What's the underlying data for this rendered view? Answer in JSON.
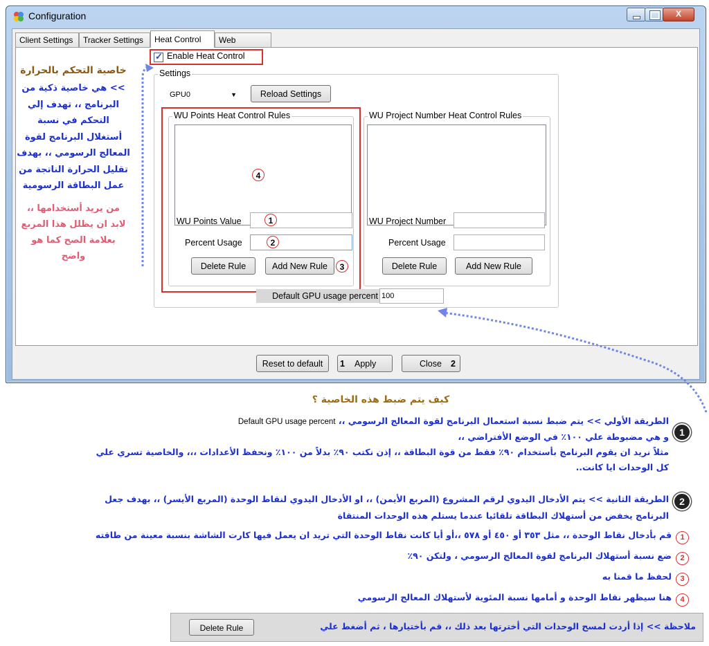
{
  "window": {
    "title": "Configuration",
    "controls": {
      "minimize": "",
      "maximize": "",
      "close": "X"
    }
  },
  "tabs": [
    {
      "label": "Client Settings"
    },
    {
      "label": "Tracker Settings"
    },
    {
      "label": "Heat Control"
    },
    {
      "label": "Web Settings"
    }
  ],
  "heat_control": {
    "enable_label": "Enable Heat Control",
    "enable_checked": true,
    "settings_group_label": "Settings",
    "gpu_select": "GPU0",
    "reload_button": "Reload Settings",
    "wu_points": {
      "group_label": "WU Points Heat Control Rules",
      "value_label": "WU Points Value",
      "value": "",
      "percent_label": "Percent Usage",
      "percent": "",
      "delete_button": "Delete Rule",
      "add_button": "Add New Rule"
    },
    "wu_project": {
      "group_label": "WU Project Number Heat Control Rules",
      "number_label": "WU Project Number",
      "number": "",
      "percent_label": "Percent Usage",
      "percent": "",
      "delete_button": "Delete Rule",
      "add_button": "Add New Rule"
    },
    "default_gpu_label": "Default GPU usage percent",
    "default_gpu_value": "100"
  },
  "footer_buttons": {
    "reset": "Reset to default",
    "apply": "Apply",
    "close": "Close"
  },
  "markers": {
    "m1": "1",
    "m2": "2",
    "m3": "3",
    "m4": "4"
  },
  "annotations": {
    "left_title": "خاصية التحكم بالحرارة",
    "left_blue": [
      ">> هي خاصية ذكية من",
      "البرنامج ،، تهدف إلي",
      "التحكم في نسبة",
      "أستغلال البرنامج لقوة",
      "المعالج الرسومي ،، بهدف",
      "تقليل الحرارة الناتجة من",
      "عمل البطاقة الرسومية"
    ],
    "left_pink": [
      "من يريد أستخدامها ،،",
      "لابد ان يظلل هذا المربع",
      "بعلامة الصح كما هو",
      "واضح"
    ],
    "how_title": "كيف يتم ضبط هذه الخاصية ؟",
    "method1": {
      "number": "1",
      "line1": "الطريقة الأولي >> يتم ضبط نسبة استعمال البرنامج لقوة المعالج الرسومي ،،",
      "line1_en": "Default GPU usage percent",
      "line2": "و هي مضبوطة علي ١٠٠٪ في الوضع الأفتراضي ،،",
      "line3": "مثلاً نريد ان يقوم البرنامج بأستخدام ٩٠٪ فقط من قوة البطاقة ،، إذن نكتب ٩٠٪ بدلاً من ١٠٠٪ ونحفظ الأعدادات ،،، والخاصية تسري علي",
      "line4": "كل الوحدات ايا كانت.."
    },
    "method2": {
      "number": "2",
      "line1": "الطريقة الثانية >> يتم الأدخال اليدوي لرقم المشروع (المربع الأيمن) ،، او الأدخال اليدوي لنقاط الوحدة (المربع الأيسر) ،، بهدف جعل",
      "line2": "البرنامج يخفض من أستهلاك البطاقة تلقائيا عندما يستلم هذه الوحدات المنتقاة"
    },
    "steps": [
      {
        "n": "1",
        "text": "قم بأدخال نقاط الوحدة ،، مثل ٣٥٣ أو ٤٥٠ أو ٥٧٨ ،،أو أيا كانت نقاط الوحدة التي تريد ان يعمل فيها كارت الشاشة بنسبة معينة من طاقته"
      },
      {
        "n": "2",
        "text": "ضع نسبة أستهلاك البرنامج لقوة المعالج الرسومي ، ولتكن ٩٠٪"
      },
      {
        "n": "3",
        "text": "لحفظ ما قمنا به"
      },
      {
        "n": "4",
        "text": "هنا سيظهر نقاط الوحدة و أمامها نسبة المئوية لأستهلاك المعالج الرسومي"
      }
    ],
    "note": {
      "text": "ملاحظة >> إذا أردت لمسح الوحدات التي أخترتها بعد ذلك ،، قم بأختيارها ، ثم أضغط علي",
      "button": "Delete Rule"
    }
  },
  "colors": {
    "red_marker": "#d9302c",
    "annotation_blue": "#1c2fd0",
    "annotation_brown": "#8a5a12",
    "annotation_pink": "#e25b73"
  }
}
